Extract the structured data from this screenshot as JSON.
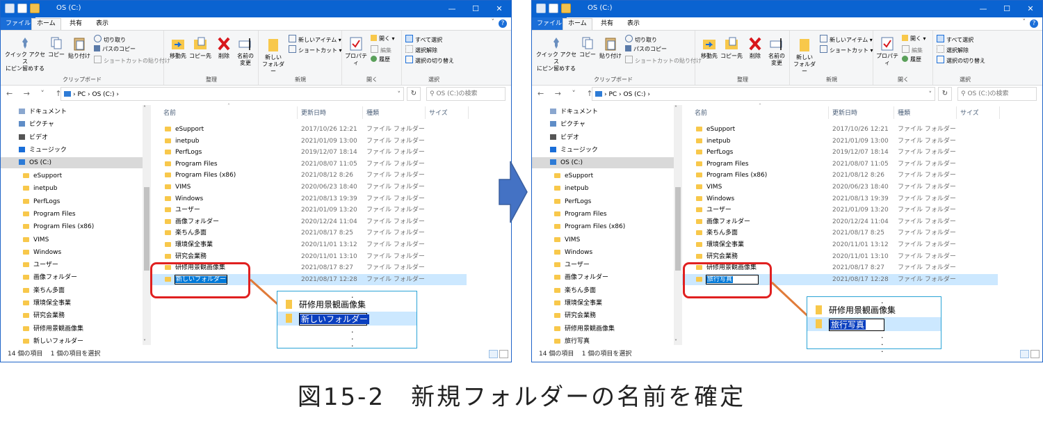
{
  "window": {
    "title": "OS (C:)",
    "controls": [
      "—",
      "☐",
      "✕"
    ],
    "tabs": {
      "file": "ファイル",
      "home": "ホーム",
      "share": "共有",
      "view": "表示"
    },
    "help": "?",
    "ribbon": {
      "clipboard": {
        "pin": "クイック アクセス\nにピン留めする",
        "copy": "コピー",
        "paste": "貼り付け",
        "cut": "切り取り",
        "copy_path": "パスのコピー",
        "paste_shortcut": "ショートカットの貼り付け",
        "group": "クリップボード"
      },
      "organize": {
        "move_to": "移動先",
        "copy_to": "コピー先",
        "delete": "削除",
        "rename": "名前の\n変更",
        "group": "整理"
      },
      "new": {
        "new_folder": "新しい\nフォルダー",
        "new_item": "新しいアイテム ▾",
        "shortcut": "ショートカット ▾",
        "group": "新規"
      },
      "open": {
        "properties": "プロパティ",
        "open": "開く ▾",
        "edit": "編集",
        "history": "履歴",
        "group": "開く"
      },
      "select": {
        "select_all": "すべて選択",
        "select_none": "選択解除",
        "invert": "選択の切り替え",
        "group": "選択"
      }
    },
    "address": {
      "nav": "← → ˅ ↑",
      "path": "› PC › OS (C:) ›",
      "refresh": "↻",
      "search_placeholder": "⚲  OS (C:)の検索"
    },
    "columns": {
      "name": "名前",
      "date": "更新日時",
      "type": "種類",
      "size": "サイズ"
    },
    "nav_top": [
      "ドキュメント",
      "ピクチャ",
      "ビデオ",
      "ミュージック",
      "OS (C:)"
    ],
    "folder_type": "ファイル フォルダー",
    "files": [
      {
        "name": "eSupport",
        "date": "2017/10/26 12:21"
      },
      {
        "name": "inetpub",
        "date": "2021/01/09 13:00"
      },
      {
        "name": "PerfLogs",
        "date": "2019/12/07 18:14"
      },
      {
        "name": "Program Files",
        "date": "2021/08/07 11:05"
      },
      {
        "name": "Program Files (x86)",
        "date": "2021/08/12 8:26"
      },
      {
        "name": "VIMS",
        "date": "2020/06/23 18:40"
      },
      {
        "name": "Windows",
        "date": "2021/08/13 19:39"
      },
      {
        "name": "ユーザー",
        "date": "2021/01/09 13:20"
      },
      {
        "name": "画像フォルダー",
        "date": "2020/12/24 11:04"
      },
      {
        "name": "楽ちん多面",
        "date": "2021/08/17 8:25"
      },
      {
        "name": "環境保全事業",
        "date": "2020/11/01 13:12"
      },
      {
        "name": "研究会業務",
        "date": "2020/11/01 13:10"
      },
      {
        "name": "研修用景観画像集",
        "date": "2021/08/17 8:27"
      }
    ],
    "new_row_date": "2021/08/17 12:28",
    "status_count": "14 個の項目",
    "status_selected": "1 個の項目を選択"
  },
  "left": {
    "new_name": "新しいフォルダー",
    "zoom_prev": "研修用景観画像集",
    "zoom_new": "新しいフォルダー"
  },
  "right": {
    "new_name": "旅行写真",
    "zoom_prev": "研修用景観画像集",
    "zoom_new": "旅行写真"
  },
  "caption": "図15-2　新規フォルダーの名前を確定"
}
